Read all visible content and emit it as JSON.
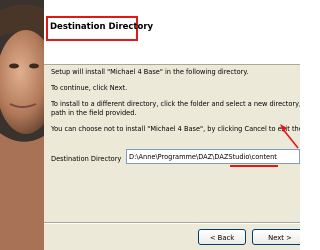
{
  "header": {
    "title": "Destination Directory"
  },
  "body": {
    "line_install": "Setup will install \"Michael 4 Base\" in the following directory.",
    "line_continue": "To continue, click Next.",
    "line_different_1": "To install to a different directory, click the folder and select a new directory, o",
    "line_different_2": "path in the field provided.",
    "line_cancel": "You can choose not to install \"Michael 4 Base\", by clicking Cancel to exit the S"
  },
  "destination": {
    "label": "Destination Directory",
    "value": "D:\\Anne\\Programme\\DAZ\\DAZStudio\\content"
  },
  "buttons": {
    "back_label": "< Back",
    "next_label": "Next >"
  },
  "colors": {
    "annotation": "#e01818",
    "dialog_face": "#ece9d8",
    "input_border": "#7f9db9"
  }
}
